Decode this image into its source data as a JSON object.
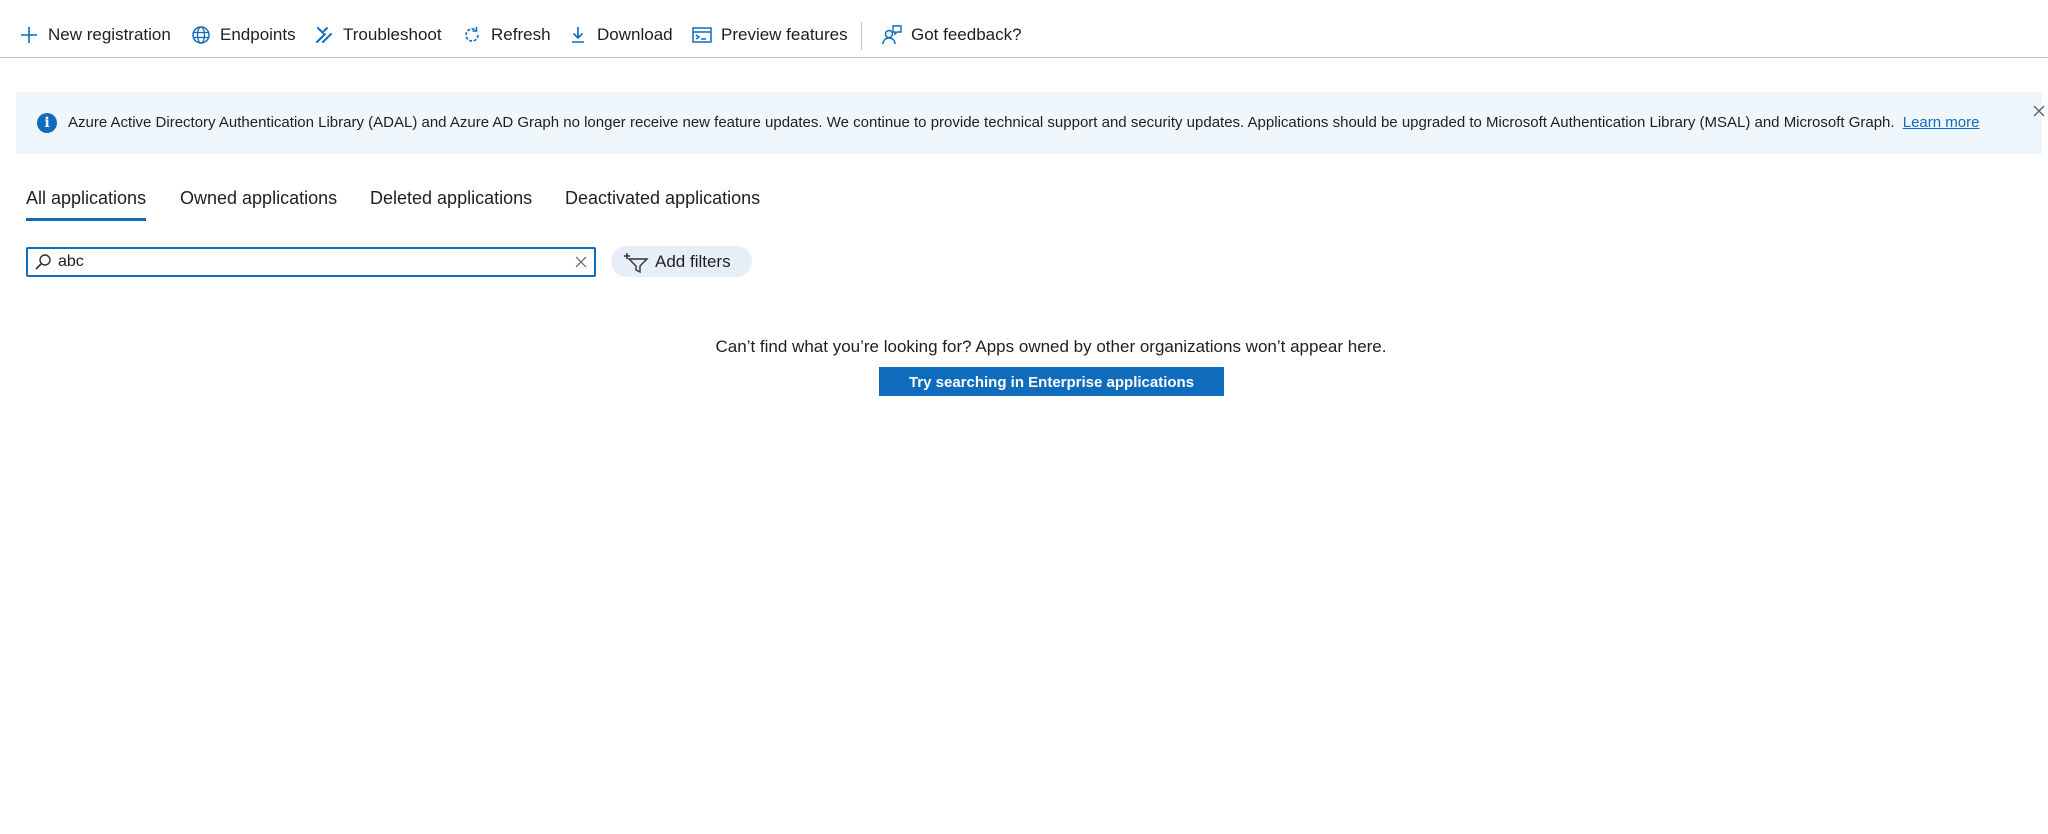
{
  "toolbar": {
    "new_registration": "New registration",
    "endpoints": "Endpoints",
    "troubleshoot": "Troubleshoot",
    "refresh": "Refresh",
    "download": "Download",
    "preview_features": "Preview features",
    "got_feedback": "Got feedback?"
  },
  "banner": {
    "message": "Azure Active Directory Authentication Library (ADAL) and Azure AD Graph no longer receive new feature updates. We continue to provide technical support and security updates. Applications should be upgraded to Microsoft Authentication Library (MSAL) and Microsoft Graph.",
    "link": "Learn more",
    "info_icon": "i"
  },
  "tabs": [
    {
      "label": "All applications",
      "active": true
    },
    {
      "label": "Owned applications",
      "active": false
    },
    {
      "label": "Deleted applications",
      "active": false
    },
    {
      "label": "Deactivated applications",
      "active": false
    }
  ],
  "search": {
    "value": "abc"
  },
  "filters": {
    "add_label": "Add filters"
  },
  "empty_state": {
    "message": "Can’t find what you’re looking for? Apps owned by other organizations won’t appear here.",
    "button": "Try searching in Enterprise applications"
  },
  "colors": {
    "accent": "#0f6cbd",
    "banner_bg": "#eff6fc",
    "filter_bg": "#e6eef8"
  },
  "icons": {
    "new_registration": "plus-icon",
    "endpoints": "globe-icon",
    "troubleshoot": "tools-icon",
    "refresh": "refresh-icon",
    "download": "download-icon",
    "preview_features": "preview-icon",
    "got_feedback": "feedback-icon"
  }
}
